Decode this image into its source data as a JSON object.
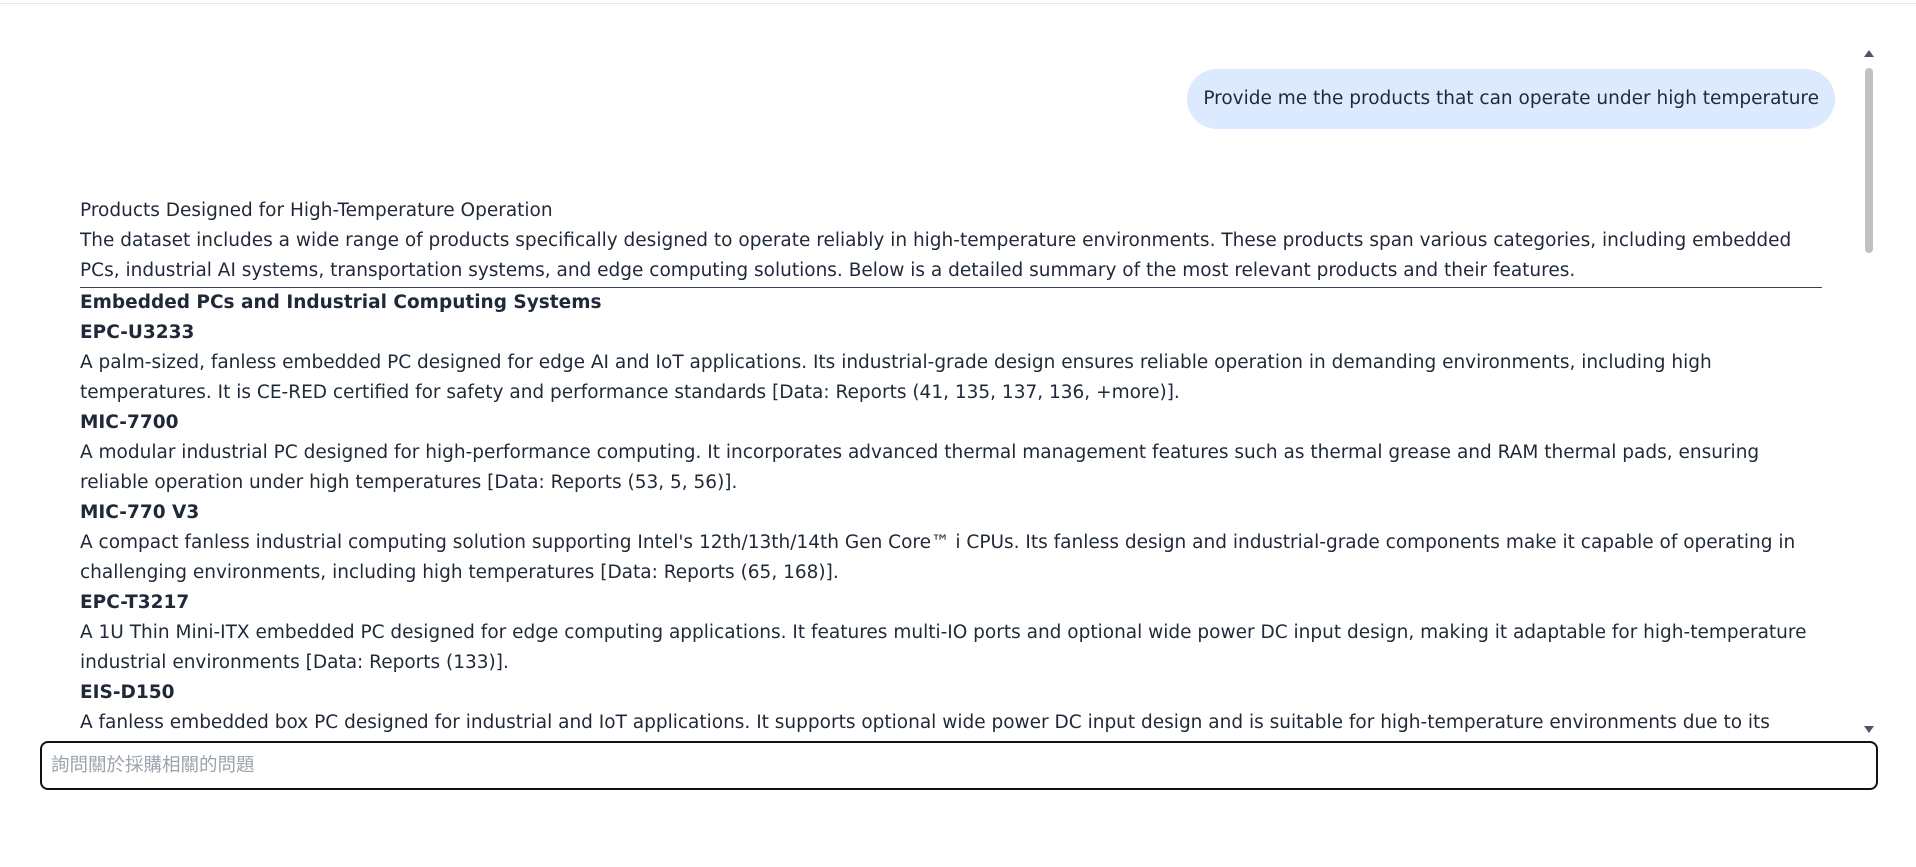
{
  "chat": {
    "user_message": "Provide me the products that can operate under high temperature",
    "answer": {
      "title": "Products Designed for High-Temperature Operation",
      "intro": "The dataset includes a wide range of products specifically designed to operate reliably in high-temperature environments. These products span various categories, including embedded PCs, industrial AI systems, transportation systems, and edge computing solutions. Below is a detailed summary of the most relevant products and their features.",
      "section_heading": "Embedded PCs and Industrial Computing Systems",
      "products": [
        {
          "name": "EPC-U3233",
          "description": "A palm-sized, fanless embedded PC designed for edge AI and IoT applications. Its industrial-grade design ensures reliable operation in demanding environments, including high temperatures. It is CE-RED certified for safety and performance standards [Data: Reports (41, 135, 137, 136, +more)]."
        },
        {
          "name": "MIC-7700",
          "description": "A modular industrial PC designed for high-performance computing. It incorporates advanced thermal management features such as thermal grease and RAM thermal pads, ensuring reliable operation under high temperatures [Data: Reports (53, 5, 56)]."
        },
        {
          "name": "MIC-770 V3",
          "description": "A compact fanless industrial computing solution supporting Intel's 12th/13th/14th Gen Core™ i CPUs. Its fanless design and industrial-grade components make it capable of operating in challenging environments, including high temperatures [Data: Reports (65, 168)]."
        },
        {
          "name": "EPC-T3217",
          "description": "A 1U Thin Mini-ITX embedded PC designed for edge computing applications. It features multi-IO ports and optional wide power DC input design, making it adaptable for high-temperature industrial environments [Data: Reports (133)]."
        },
        {
          "name": "EIS-D150",
          "description": "A fanless embedded box PC designed for industrial and IoT applications. It supports optional wide power DC input design and is suitable for high-temperature environments due to its robust"
        }
      ]
    }
  },
  "composer": {
    "placeholder": "詢問關於採購相關的問題",
    "value": ""
  }
}
